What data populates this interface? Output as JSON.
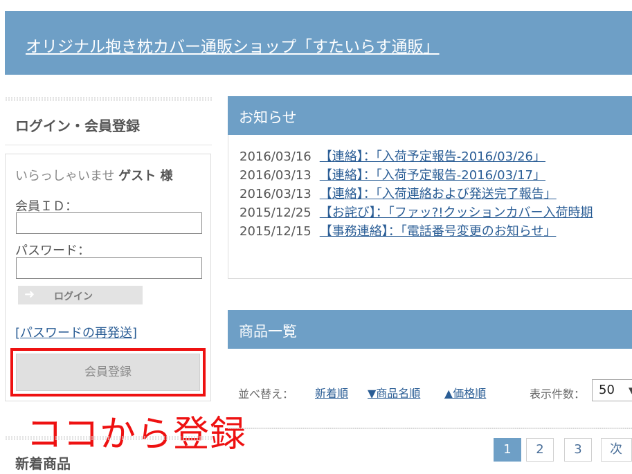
{
  "header": {
    "site_title": "オリジナル抱き枕カバー通販ショップ「すたいらす通販」"
  },
  "sidebar": {
    "login_heading": "ログイン・会員登録",
    "greeting_prefix": "いらっしゃいませ",
    "greeting_user": "ゲスト 様",
    "member_id_label": "会員ＩＤ：",
    "member_id_value": "",
    "password_label": "パスワード：",
    "password_value": "",
    "login_button": "ログイン",
    "resend_password_link": "[パスワードの再発送]",
    "register_button": "会員登録",
    "new_products_heading": "新着商品"
  },
  "annotation": {
    "text": "ココから登録",
    "color": "#ee1111"
  },
  "news": {
    "heading": "お知らせ",
    "items": [
      {
        "date": "2016/03/16",
        "title": "【連絡】：「入荷予定報告-2016/03/26」"
      },
      {
        "date": "2016/03/13",
        "title": "【連絡】：「入荷予定報告-2016/03/17」"
      },
      {
        "date": "2016/03/13",
        "title": "【連絡】：「入荷連絡および発送完了報告」"
      },
      {
        "date": "2015/12/25",
        "title": "【お詫び】：「ファッ?!クッションカバー入荷時期"
      },
      {
        "date": "2015/12/15",
        "title": "【事務連絡】：「電話番号変更のお知らせ」"
      }
    ]
  },
  "products": {
    "heading": "商品一覧",
    "sort_label": "並べ替え：",
    "sort_options": [
      "新着順",
      "▼商品名順",
      "▲価格順"
    ],
    "per_page_label": "表示件数：",
    "per_page_value": "50",
    "pagination": [
      "1",
      "2",
      "3",
      "次へ"
    ],
    "current_page": "1"
  },
  "colors": {
    "accent": "#6e9fc6",
    "link": "#2a5d95",
    "highlight": "#ee1111"
  }
}
